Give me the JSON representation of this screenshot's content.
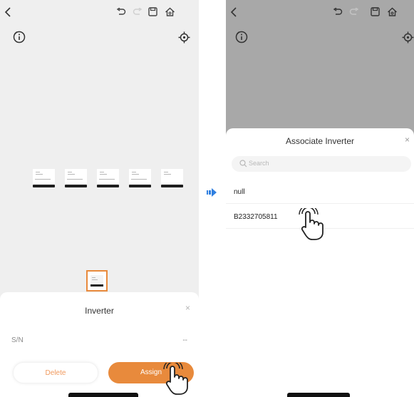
{
  "left_screen": {
    "sheet": {
      "title": "Inverter",
      "close": "×",
      "sn_label": "S/N",
      "sn_value": "--",
      "delete_label": "Delete",
      "assign_label": "Assign"
    }
  },
  "right_screen": {
    "sheet": {
      "title": "Associate Inverter",
      "close": "×",
      "search_placeholder": "Search",
      "items": [
        {
          "label": "null"
        },
        {
          "label": "B2332705811"
        }
      ]
    }
  },
  "icons": [
    "back-icon",
    "undo-icon",
    "redo-icon",
    "save-icon",
    "home-icon",
    "info-icon",
    "locate-icon",
    "search-icon",
    "hand-pointer-icon",
    "arrow-right-icon"
  ],
  "colors": {
    "accent": "#e88a3c",
    "arrow": "#2f7fe0"
  }
}
